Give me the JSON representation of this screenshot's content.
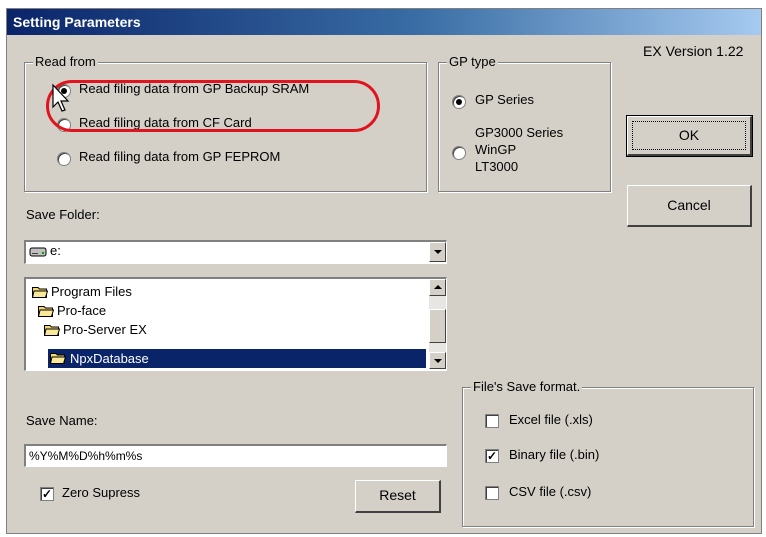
{
  "window": {
    "title": "Setting Parameters",
    "version": "EX Version 1.22"
  },
  "read_from": {
    "legend": "Read from",
    "options": [
      {
        "label": "Read filing data from GP Backup SRAM",
        "checked": true
      },
      {
        "label": "Read filing data from CF Card",
        "checked": false
      },
      {
        "label": "Read filing data from GP FEPROM",
        "checked": false
      }
    ]
  },
  "gp_type": {
    "legend": "GP type",
    "options": [
      {
        "label": "GP Series",
        "checked": true
      },
      {
        "lines": [
          "GP3000 Series",
          "WinGP",
          "LT3000"
        ],
        "checked": false
      }
    ]
  },
  "buttons": {
    "ok": "OK",
    "cancel": "Cancel",
    "reset": "Reset"
  },
  "save_folder": {
    "label": "Save Folder:",
    "drive": "e:",
    "folders": [
      {
        "name": "Program Files",
        "selected": false
      },
      {
        "name": "Pro-face",
        "selected": false
      },
      {
        "name": "Pro-Server EX",
        "selected": false
      },
      {
        "name": "NpxDatabase",
        "selected": true
      }
    ]
  },
  "save_name": {
    "label": "Save Name:",
    "value": "%Y%M%D%h%m%s"
  },
  "zero_supress": {
    "label": "Zero Supress",
    "checked": true
  },
  "save_format": {
    "legend": "File's Save format.",
    "options": [
      {
        "label": "Excel file (.xls)",
        "checked": false
      },
      {
        "label": "Binary file (.bin)",
        "checked": true
      },
      {
        "label": "CSV file (.csv)",
        "checked": false
      }
    ]
  },
  "colors": {
    "highlight": "#e0141e",
    "title_bar": "#0a246a",
    "selection": "#0a246a"
  }
}
